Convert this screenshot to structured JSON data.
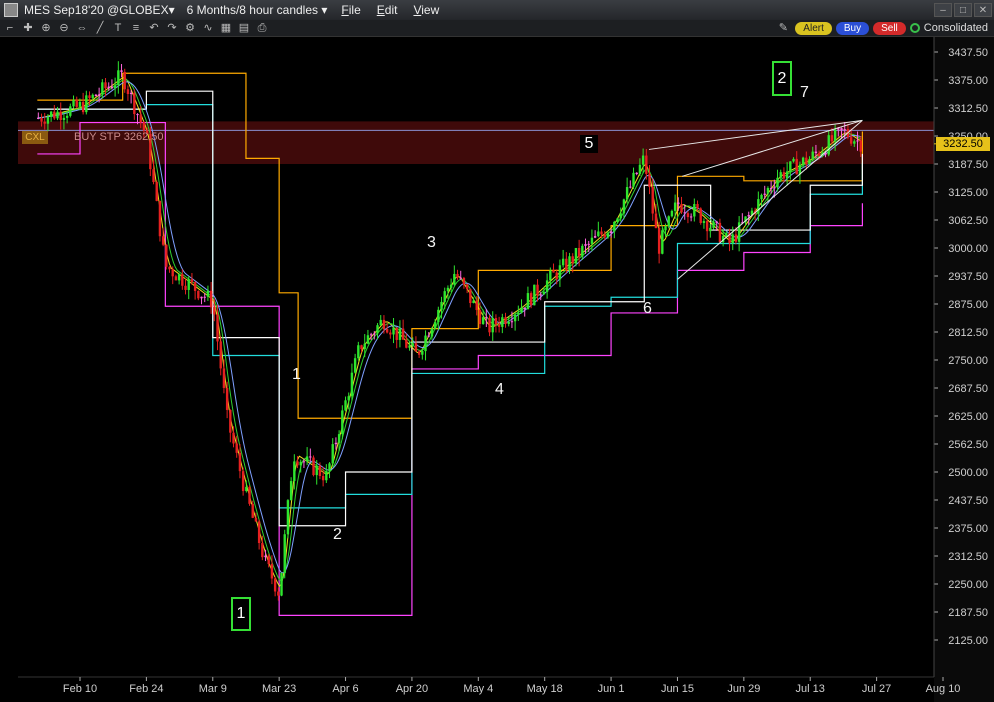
{
  "window": {
    "title": "MES Sep18'20",
    "exchange": "@GLOBEX",
    "period": "6 Months/8 hour candles",
    "menus": [
      "File",
      "Edit",
      "View"
    ]
  },
  "toolbar": {
    "alert": "Alert",
    "buy": "Buy",
    "sell": "Sell",
    "consolidated": "Consolidated"
  },
  "order": {
    "cancel": "CXL",
    "label": "BUY STP 3262.50"
  },
  "price_tag": "3232.50",
  "annotations": {
    "a1": "1",
    "a2": "2",
    "a3": "3",
    "a4": "4",
    "a5": "5",
    "a6": "6",
    "a7": "7",
    "box1": "1",
    "box2": "2"
  },
  "colors": {
    "background": "#000000",
    "up_candle": "#2ee62e",
    "down_candle": "#e62020",
    "doji": "#ff66dd",
    "price_tag": "#e6c21a",
    "order_band": "#4a0c0c"
  },
  "chart_data": {
    "type": "line",
    "title": "",
    "x_tick_labels": [
      "Feb 10",
      "Feb 24",
      "Mar 9",
      "Mar 23",
      "Apr 6",
      "Apr 20",
      "May 4",
      "May 18",
      "Jun 1",
      "Jun 15",
      "Jun 29",
      "Jul 13",
      "Jul 27",
      "Aug 10"
    ],
    "y_tick_labels": [
      "3437.50",
      "3375.00",
      "3312.50",
      "3250.00",
      "3187.50",
      "3125.00",
      "3062.50",
      "3000.00",
      "2937.50",
      "2875.00",
      "2812.50",
      "2750.00",
      "2687.50",
      "2625.00",
      "2562.50",
      "2500.00",
      "2437.50",
      "2375.00",
      "2312.50",
      "2250.00",
      "2187.50",
      "2125.00"
    ],
    "ylim": [
      2090,
      3465
    ],
    "last_price": 3232.5,
    "stop_order_price": 3262.5,
    "price_path": {
      "dates": [
        "Feb 1",
        "Feb 10",
        "Feb 19",
        "Feb 24",
        "Feb 28",
        "Mar 9",
        "Mar 12",
        "Mar 16",
        "Mar 20",
        "Mar 23",
        "Mar 26",
        "Apr 2",
        "Apr 9",
        "Apr 14",
        "Apr 21",
        "Apr 29",
        "May 6",
        "May 13",
        "May 20",
        "Jun 1",
        "Jun 8",
        "Jun 11",
        "Jun 15",
        "Jun 19",
        "Jun 26",
        "Jul 6",
        "Jul 13",
        "Jul 20",
        "Jul 24"
      ],
      "values": [
        3290,
        3315,
        3385,
        3250,
        2960,
        2880,
        2620,
        2450,
        2300,
        2230,
        2540,
        2490,
        2780,
        2840,
        2760,
        2945,
        2820,
        2870,
        2940,
        3050,
        3200,
        3000,
        3100,
        3080,
        3010,
        3160,
        3200,
        3260,
        3232.5
      ]
    },
    "bands": [
      {
        "name": "",
        "color": "#ff44ff",
        "dates": [
          "Feb 1",
          "Feb 10",
          "Feb 28",
          "Mar 9",
          "Mar 23",
          "Apr 6",
          "Apr 20",
          "May 4",
          "May 18",
          "Jun 1",
          "Jun 15",
          "Jun 29",
          "Jul 13",
          "Jul 24"
        ],
        "values": [
          3210,
          3280,
          2870,
          2870,
          2180,
          2180,
          2730,
          2760,
          2760,
          2855,
          2950,
          2990,
          3050,
          3100
        ]
      },
      {
        "name": "",
        "color": "#ffaa00",
        "dates": [
          "Feb 1",
          "Feb 19",
          "Mar 9",
          "Mar 16",
          "Mar 23",
          "Mar 27",
          "Apr 20",
          "May 4",
          "Jun 1",
          "Jun 15",
          "Jun 29",
          "Jul 24"
        ],
        "values": [
          3330,
          3390,
          3390,
          3200,
          2900,
          2620,
          2820,
          2950,
          3050,
          3160,
          3150,
          3260
        ]
      },
      {
        "name": "",
        "color": "#22dddd",
        "dates": [
          "Feb 1",
          "Feb 24",
          "Mar 9",
          "Mar 23",
          "Apr 6",
          "Apr 20",
          "May 18",
          "Jun 1",
          "Jun 15",
          "Jul 13",
          "Jul 24"
        ],
        "values": [
          3310,
          3320,
          2760,
          2420,
          2450,
          2720,
          2870,
          2890,
          3010,
          3120,
          3190
        ]
      },
      {
        "name": "",
        "color": "#ffffff",
        "dates": [
          "Feb 1",
          "Feb 24",
          "Mar 9",
          "Mar 23",
          "Apr 6",
          "Apr 20",
          "May 18",
          "Jun 8",
          "Jun 22",
          "Jul 13",
          "Jul 24"
        ],
        "values": [
          3310,
          3350,
          2800,
          2380,
          2500,
          2790,
          2880,
          3140,
          3040,
          3140,
          3210
        ]
      }
    ],
    "trend_lines": [
      {
        "from": [
          "Jun 9",
          3220
        ],
        "to": [
          "Jul 24",
          3285
        ]
      },
      {
        "from": [
          "Jun 15",
          2930
        ],
        "to": [
          "Jul 24",
          3285
        ]
      },
      {
        "from": [
          "Jun 16",
          3160
        ],
        "to": [
          "Jul 24",
          3285
        ]
      }
    ],
    "grid": false,
    "legend": "none"
  }
}
